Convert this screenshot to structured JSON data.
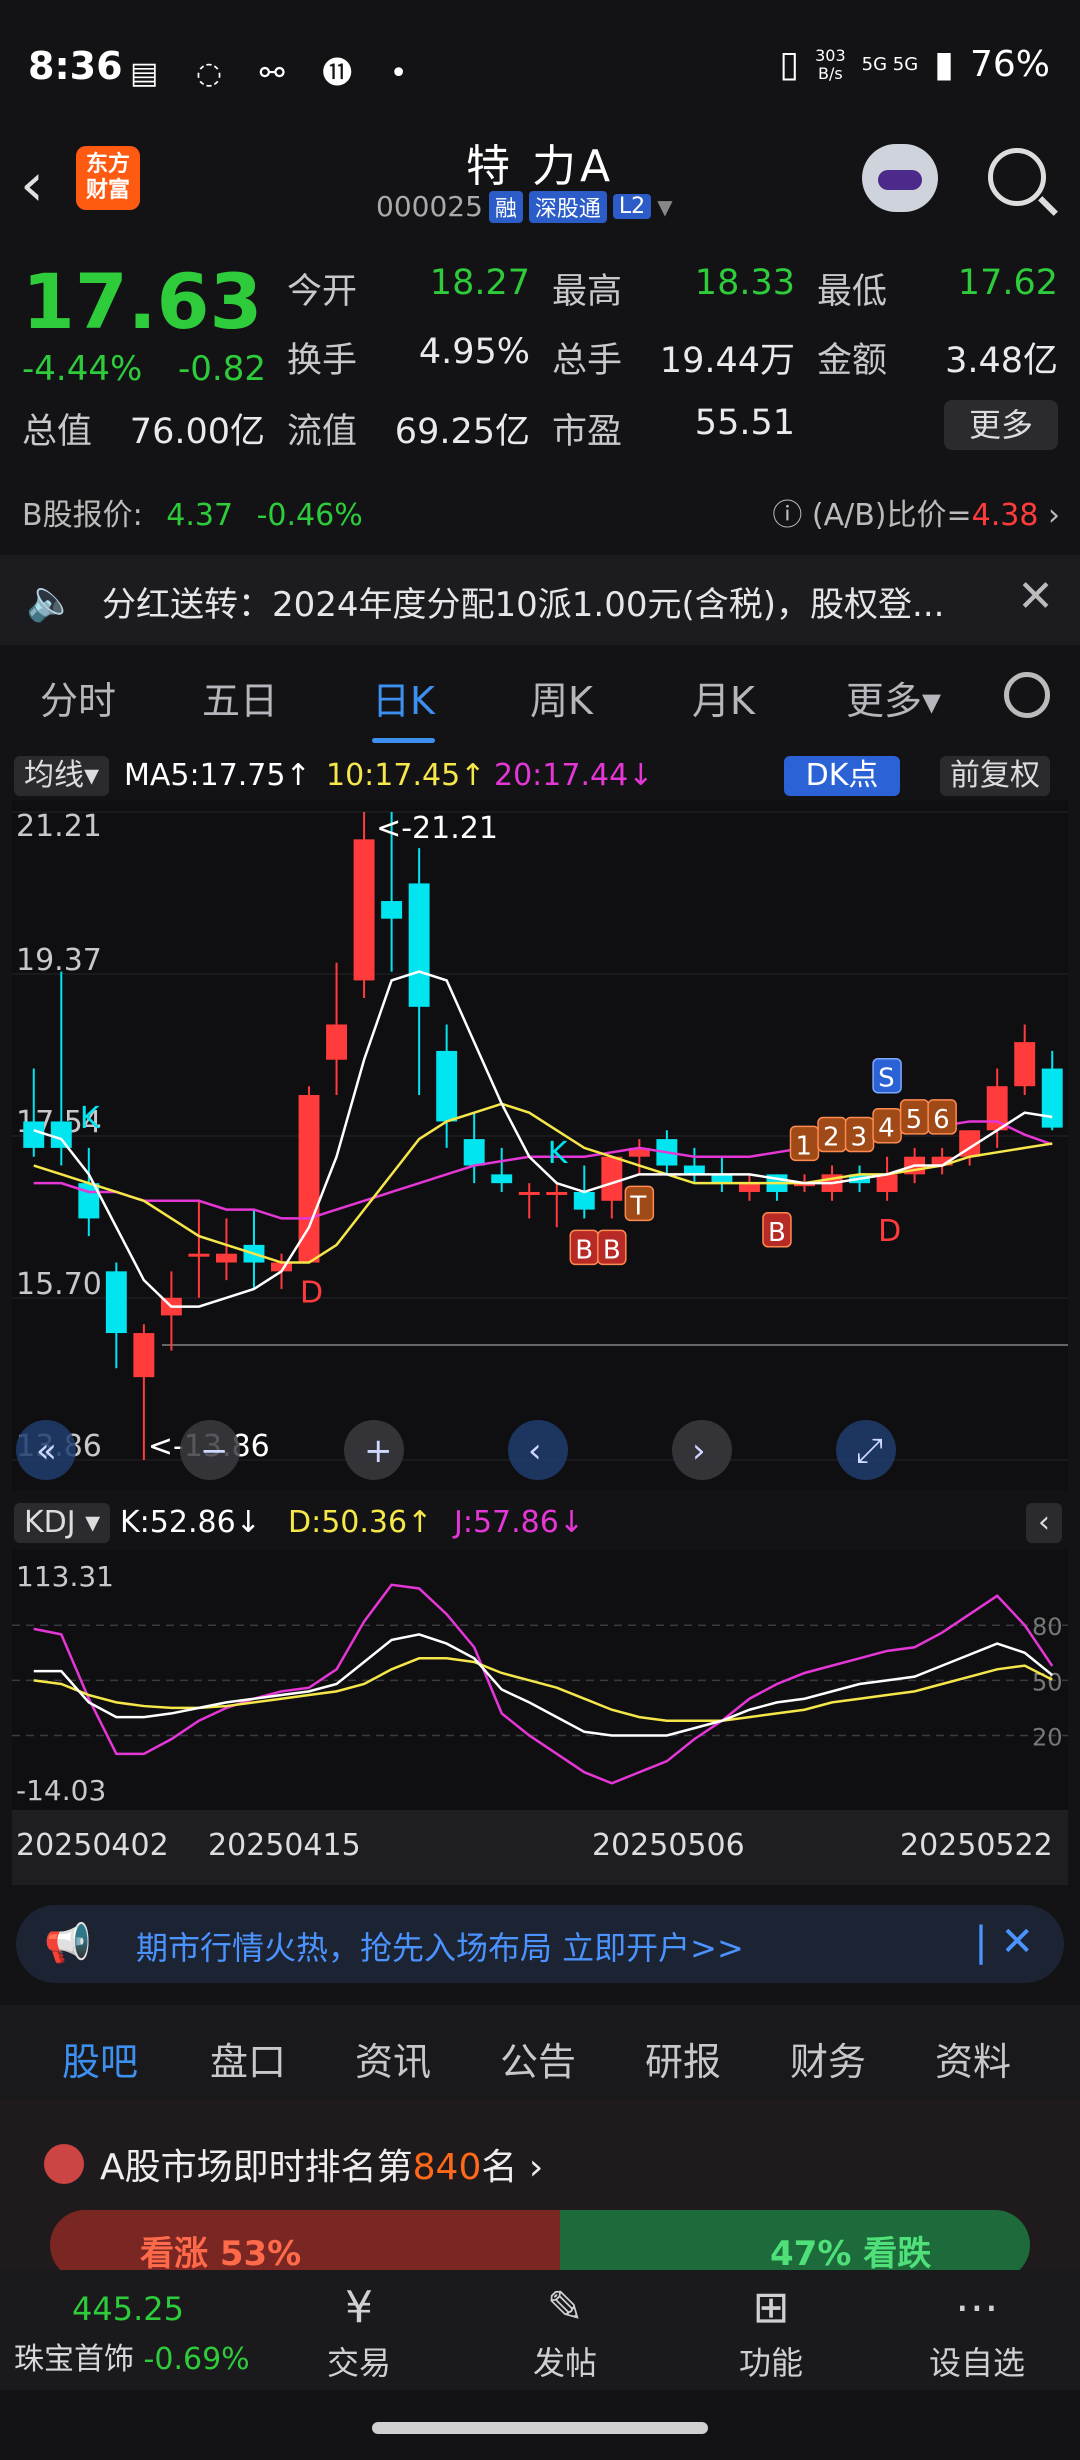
{
  "status_bar": {
    "time": "8:36",
    "net_speed": "303",
    "net_unit": "B/s",
    "signal": "5G 5G",
    "battery": "76%"
  },
  "header": {
    "logo_text": "东方财富",
    "stock_name": "特 力A",
    "code": "000025",
    "tags": [
      "融",
      "深股通",
      "L2"
    ]
  },
  "quote": {
    "price": "17.63",
    "change_pct": "-4.44%",
    "change": "-0.82",
    "fields": [
      {
        "label": "今开",
        "value": "18.27",
        "color": "green"
      },
      {
        "label": "最高",
        "value": "18.33",
        "color": "green"
      },
      {
        "label": "最低",
        "value": "17.62",
        "color": "green"
      },
      {
        "label": "换手",
        "value": "4.95%",
        "color": "white"
      },
      {
        "label": "总手",
        "value": "19.44万",
        "color": "white"
      },
      {
        "label": "金额",
        "value": "3.48亿",
        "color": "white"
      },
      {
        "label": "总值",
        "value": "76.00亿",
        "color": "white"
      },
      {
        "label": "流值",
        "value": "69.25亿",
        "color": "white"
      },
      {
        "label": "市盈",
        "value": "55.51",
        "color": "white"
      }
    ],
    "more_label": "更多",
    "b_label": "B股报价:",
    "b_price": "4.37",
    "b_change": "-0.46%",
    "ratio_label": "(A/B)比价=",
    "ratio_value": "4.38"
  },
  "dividend_banner": {
    "text": "分红送转：2024年度分配10派1.00元(含税)，股权登..."
  },
  "chart_tabs": [
    "分时",
    "五日",
    "日K",
    "周K",
    "月K",
    "更多▾"
  ],
  "ma_bar": {
    "selector": "均线▾",
    "ma5": "MA5:17.75↑",
    "ma10": "10:17.45↑",
    "ma20": "20:17.44↓",
    "dk_label": "DK点",
    "adjust_label": "前复权"
  },
  "colors": {
    "up": "#ff3b3b",
    "down": "#00e5ef",
    "ma5": "#ffffff",
    "ma10": "#f5e64a",
    "ma20": "#e536d6",
    "accent": "#3d8ff0"
  },
  "chart_data": [
    {
      "type": "candlestick",
      "y_ticks": [
        "21.21",
        "19.37",
        "17.54",
        "15.70",
        "13.86"
      ],
      "ylim": [
        13.86,
        21.21
      ],
      "x_labels": [
        "20250402",
        "20250415",
        "20250506",
        "20250522"
      ],
      "max_label": "<-21.21",
      "min_label": "<-13.86",
      "candles": [
        {
          "o": 17.7,
          "h": 18.3,
          "l": 17.3,
          "c": 17.4
        },
        {
          "o": 17.7,
          "h": 19.4,
          "l": 17.2,
          "c": 17.4
        },
        {
          "o": 17.0,
          "h": 17.4,
          "l": 16.4,
          "c": 16.6
        },
        {
          "o": 16.0,
          "h": 16.1,
          "l": 14.9,
          "c": 15.3
        },
        {
          "o": 14.8,
          "h": 15.4,
          "l": 13.86,
          "c": 15.3
        },
        {
          "o": 15.5,
          "h": 16.0,
          "l": 15.1,
          "c": 15.7
        },
        {
          "o": 16.2,
          "h": 16.8,
          "l": 15.7,
          "c": 16.2
        },
        {
          "o": 16.1,
          "h": 16.6,
          "l": 15.9,
          "c": 16.2
        },
        {
          "o": 16.3,
          "h": 16.7,
          "l": 15.8,
          "c": 16.1
        },
        {
          "o": 16.0,
          "h": 16.2,
          "l": 15.8,
          "c": 16.1
        },
        {
          "o": 16.1,
          "h": 18.1,
          "l": 16.1,
          "c": 18.0
        },
        {
          "o": 18.4,
          "h": 19.5,
          "l": 18.0,
          "c": 18.8
        },
        {
          "o": 19.3,
          "h": 21.21,
          "l": 19.1,
          "c": 20.9
        },
        {
          "o": 20.2,
          "h": 21.21,
          "l": 19.4,
          "c": 20.0
        },
        {
          "o": 20.4,
          "h": 20.8,
          "l": 18.0,
          "c": 19.0
        },
        {
          "o": 18.5,
          "h": 18.8,
          "l": 17.4,
          "c": 17.7
        },
        {
          "o": 17.5,
          "h": 17.8,
          "l": 17.0,
          "c": 17.2
        },
        {
          "o": 17.1,
          "h": 17.4,
          "l": 16.9,
          "c": 17.0
        },
        {
          "o": 16.9,
          "h": 17.0,
          "l": 16.6,
          "c": 16.9
        },
        {
          "o": 16.9,
          "h": 17.0,
          "l": 16.5,
          "c": 16.9
        },
        {
          "o": 16.9,
          "h": 17.2,
          "l": 16.6,
          "c": 16.7
        },
        {
          "o": 16.8,
          "h": 17.3,
          "l": 16.6,
          "c": 17.3
        },
        {
          "o": 17.3,
          "h": 17.5,
          "l": 17.1,
          "c": 17.4
        },
        {
          "o": 17.5,
          "h": 17.6,
          "l": 17.1,
          "c": 17.2
        },
        {
          "o": 17.2,
          "h": 17.4,
          "l": 17.0,
          "c": 17.1
        },
        {
          "o": 17.1,
          "h": 17.3,
          "l": 16.9,
          "c": 17.0
        },
        {
          "o": 16.9,
          "h": 17.1,
          "l": 16.8,
          "c": 17.0
        },
        {
          "o": 17.1,
          "h": 17.1,
          "l": 16.8,
          "c": 16.9
        },
        {
          "o": 17.0,
          "h": 17.1,
          "l": 16.9,
          "c": 17.0
        },
        {
          "o": 16.9,
          "h": 17.2,
          "l": 16.8,
          "c": 17.1
        },
        {
          "o": 17.1,
          "h": 17.2,
          "l": 16.9,
          "c": 17.0
        },
        {
          "o": 16.9,
          "h": 17.3,
          "l": 16.8,
          "c": 17.1
        },
        {
          "o": 17.1,
          "h": 17.4,
          "l": 17.0,
          "c": 17.3
        },
        {
          "o": 17.2,
          "h": 17.4,
          "l": 17.1,
          "c": 17.3
        },
        {
          "o": 17.3,
          "h": 17.6,
          "l": 17.2,
          "c": 17.6
        },
        {
          "o": 17.6,
          "h": 18.3,
          "l": 17.4,
          "c": 18.1
        },
        {
          "o": 18.1,
          "h": 18.8,
          "l": 18.0,
          "c": 18.6
        },
        {
          "o": 18.3,
          "h": 18.5,
          "l": 17.6,
          "c": 17.63
        }
      ],
      "ma5": [
        17.6,
        17.5,
        17.1,
        16.5,
        15.9,
        15.6,
        15.6,
        15.7,
        15.8,
        16.0,
        16.5,
        17.3,
        18.4,
        19.3,
        19.4,
        19.3,
        18.6,
        17.9,
        17.3,
        17.0,
        16.9,
        17.0,
        17.1,
        17.1,
        17.1,
        17.1,
        17.1,
        17.05,
        17.0,
        17.0,
        17.05,
        17.1,
        17.2,
        17.2,
        17.4,
        17.6,
        17.8,
        17.75
      ],
      "ma10": [
        17.2,
        17.1,
        17.0,
        16.9,
        16.8,
        16.6,
        16.4,
        16.3,
        16.2,
        16.1,
        16.1,
        16.3,
        16.7,
        17.1,
        17.5,
        17.7,
        17.8,
        17.9,
        17.8,
        17.6,
        17.4,
        17.3,
        17.2,
        17.1,
        17.0,
        17.0,
        17.0,
        17.0,
        17.0,
        17.05,
        17.1,
        17.1,
        17.15,
        17.2,
        17.3,
        17.35,
        17.4,
        17.45
      ],
      "ma20": [
        17.0,
        17.0,
        16.9,
        16.9,
        16.8,
        16.8,
        16.8,
        16.7,
        16.7,
        16.6,
        16.6,
        16.7,
        16.8,
        16.9,
        17.0,
        17.1,
        17.2,
        17.25,
        17.3,
        17.3,
        17.3,
        17.35,
        17.4,
        17.35,
        17.3,
        17.3,
        17.3,
        17.35,
        17.4,
        17.45,
        17.5,
        17.55,
        17.6,
        17.65,
        17.7,
        17.7,
        17.55,
        17.44
      ],
      "signals": [
        {
          "i": 2,
          "label": "K",
          "kind": "text-cyan",
          "pos": "above"
        },
        {
          "i": 10,
          "label": "D",
          "kind": "text-red",
          "pos": "below"
        },
        {
          "i": 19,
          "label": "K",
          "kind": "text-cyan",
          "pos": "above"
        },
        {
          "i": 20,
          "label": "B",
          "kind": "box-red",
          "pos": "below"
        },
        {
          "i": 21,
          "label": "B",
          "kind": "box-red",
          "pos": "below"
        },
        {
          "i": 22,
          "label": "T",
          "kind": "box-orange",
          "pos": "below"
        },
        {
          "i": 27,
          "label": "B",
          "kind": "box-red",
          "pos": "below"
        },
        {
          "i": 28,
          "label": "1",
          "kind": "box-orange",
          "pos": "above"
        },
        {
          "i": 29,
          "label": "2",
          "kind": "box-orange",
          "pos": "above"
        },
        {
          "i": 30,
          "label": "3",
          "kind": "box-orange",
          "pos": "above"
        },
        {
          "i": 31,
          "label": "D",
          "kind": "text-red",
          "pos": "below"
        },
        {
          "i": 31,
          "label": "4",
          "kind": "box-orange",
          "pos": "above"
        },
        {
          "i": 31,
          "label": "S",
          "kind": "box-blue",
          "pos": "above2"
        },
        {
          "i": 32,
          "label": "5",
          "kind": "box-orange",
          "pos": "above"
        },
        {
          "i": 33,
          "label": "6",
          "kind": "box-orange",
          "pos": "above"
        }
      ]
    },
    {
      "type": "line",
      "indicator": "KDJ",
      "y_ticks": [
        "113.31",
        "-14.03"
      ],
      "ylim": [
        -14.03,
        113.31
      ],
      "ref_levels": [
        "80",
        "50",
        "20"
      ],
      "series": [
        {
          "name": "K:52.86↓",
          "color": "#ffffff",
          "values": [
            55,
            55,
            38,
            30,
            30,
            32,
            35,
            38,
            40,
            42,
            44,
            48,
            60,
            72,
            75,
            70,
            62,
            45,
            38,
            30,
            22,
            20,
            20,
            20,
            24,
            28,
            34,
            38,
            40,
            44,
            48,
            50,
            52,
            58,
            64,
            70,
            65,
            52.86
          ]
        },
        {
          "name": "D:50.36↑",
          "color": "#f5e64a",
          "values": [
            50,
            48,
            42,
            38,
            36,
            35,
            35,
            36,
            38,
            40,
            42,
            44,
            48,
            56,
            62,
            62,
            60,
            54,
            50,
            46,
            40,
            34,
            30,
            28,
            28,
            28,
            30,
            32,
            34,
            38,
            40,
            42,
            44,
            48,
            52,
            56,
            58,
            50.36
          ]
        },
        {
          "name": "J:57.86↓",
          "color": "#e536d6",
          "values": [
            78,
            75,
            40,
            10,
            10,
            18,
            28,
            35,
            40,
            44,
            46,
            56,
            82,
            102,
            100,
            86,
            68,
            32,
            20,
            10,
            0,
            -6,
            0,
            6,
            18,
            28,
            40,
            48,
            54,
            58,
            62,
            66,
            68,
            76,
            86,
            96,
            80,
            57.86
          ]
        }
      ]
    }
  ],
  "promo": {
    "text": "期市行情火热，抢先入场布局 立即开户>>"
  },
  "bottom_tabs": [
    "股吧",
    "盘口",
    "资讯",
    "公告",
    "研报",
    "财务",
    "资料"
  ],
  "rank": {
    "prefix": "A股市场即时排名第",
    "num": "840",
    "suffix": "名",
    "up": "看涨 53%",
    "down": "47% 看跌"
  },
  "bottom_nav": {
    "index_value": "445.25",
    "index_name": "珠宝首饰",
    "index_change": "-0.69%",
    "items": [
      "交易",
      "发帖",
      "功能",
      "设自选"
    ]
  }
}
